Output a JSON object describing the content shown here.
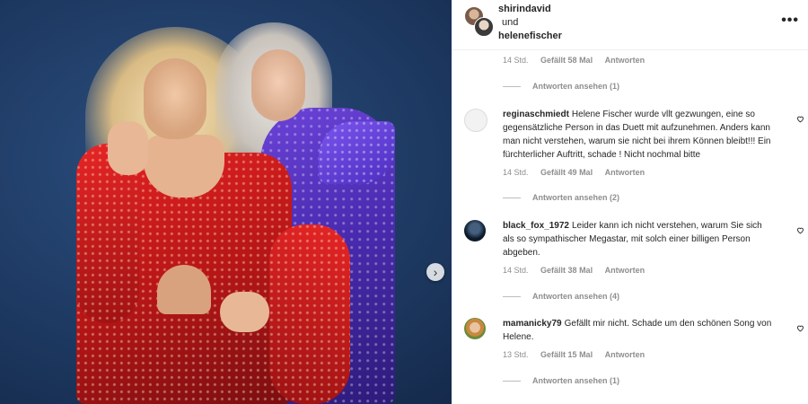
{
  "header": {
    "user1": "shirindavid",
    "connector": "und",
    "user2": "helenefischer"
  },
  "top_meta": {
    "time": "14 Std.",
    "likes": "Gefällt 58 Mal",
    "reply": "Antworten"
  },
  "top_replies": "Antworten ansehen (1)",
  "comments": [
    {
      "user": "reginaschmiedt",
      "text": "Helene Fischer wurde vllt gezwungen, eine so gegensätzliche Person in das Duett mit aufzunehmen. Anders kann man nicht verstehen, warum sie nicht bei ihrem Können bleibt!!! Ein fürchterlicher Auftritt, schade ! Nicht nochmal bitte",
      "time": "14 Std.",
      "likes": "Gefällt 49 Mal",
      "reply": "Antworten",
      "view_replies": "Antworten ansehen (2)"
    },
    {
      "user": "black_fox_1972",
      "text": "Leider kann ich nicht verstehen, warum Sie sich als so sympathischer Megastar, mit solch einer billigen Person abgeben.",
      "time": "14 Std.",
      "likes": "Gefällt 38 Mal",
      "reply": "Antworten",
      "view_replies": "Antworten ansehen (4)"
    },
    {
      "user": "mamanicky79",
      "text": "Gefällt mir nicht. Schade um den schönen Song von Helene.",
      "time": "13 Std.",
      "likes": "Gefällt 15 Mal",
      "reply": "Antworten",
      "view_replies": "Antworten ansehen (1)"
    }
  ],
  "icons": {
    "more": "more-options-icon",
    "heart": "heart-icon",
    "next": "chevron-right-icon"
  },
  "colors": {
    "text": "#262626",
    "secondary": "#8e8e8e",
    "background": "#ffffff"
  }
}
